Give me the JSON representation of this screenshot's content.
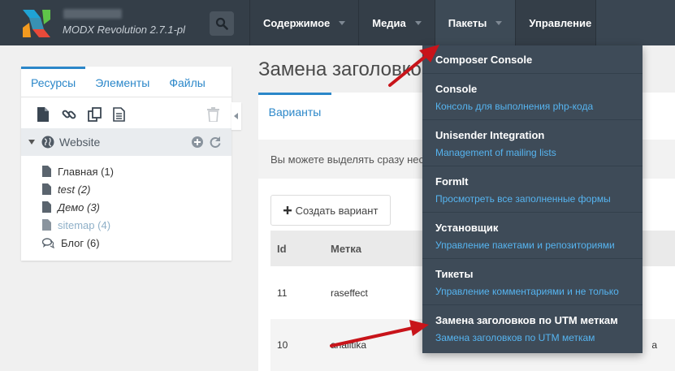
{
  "header": {
    "version": "MODX Revolution 2.7.1-pl",
    "nav": [
      {
        "label": "Содержимое"
      },
      {
        "label": "Медиа"
      },
      {
        "label": "Пакеты"
      },
      {
        "label": "Управление"
      }
    ],
    "active_nav": "Пакеты"
  },
  "sidebar": {
    "tabs": [
      {
        "label": "Ресурсы"
      },
      {
        "label": "Элементы"
      },
      {
        "label": "Файлы"
      }
    ],
    "tree_root": "Website",
    "tree": [
      {
        "label": "Главная (1)",
        "style": "normal"
      },
      {
        "label": "test (2)",
        "style": "italic"
      },
      {
        "label": "Демо (3)",
        "style": "italic"
      },
      {
        "label": "sitemap (4)",
        "style": "muted"
      },
      {
        "label": "Блог (6)",
        "style": "normal"
      }
    ]
  },
  "main": {
    "title": "Замена заголовков",
    "tab": "Варианты",
    "info": "Вы можете выделять сразу нес",
    "create_button": "Создать вариант",
    "columns": {
      "id": "Id",
      "label": "Метка"
    },
    "rows": [
      {
        "id": "11",
        "label": "raseffect",
        "extra": ""
      },
      {
        "id": "10",
        "label": "analitika",
        "extra": "a"
      }
    ]
  },
  "dropdown": {
    "items": [
      {
        "title": "Composer Console",
        "desc": ""
      },
      {
        "title": "Console",
        "desc": "Консоль для выполнения php-кода"
      },
      {
        "title": "Unisender Integration",
        "desc": "Management of mailing lists"
      },
      {
        "title": "FormIt",
        "desc": "Просмотреть все заполненные формы"
      },
      {
        "title": "Установщик",
        "desc": "Управление пакетами и репозиториями"
      },
      {
        "title": "Тикеты",
        "desc": "Управление комментариями и не только"
      },
      {
        "title": "Замена заголовков по UTM меткам",
        "desc": "Замена заголовков по UTM меткам"
      }
    ]
  },
  "colors": {
    "topbar": "#343e48",
    "dropdown": "#3e4b58",
    "link": "#2b87c9",
    "dropdown_link": "#56b4f0",
    "annotation_arrow": "#c8141a"
  }
}
